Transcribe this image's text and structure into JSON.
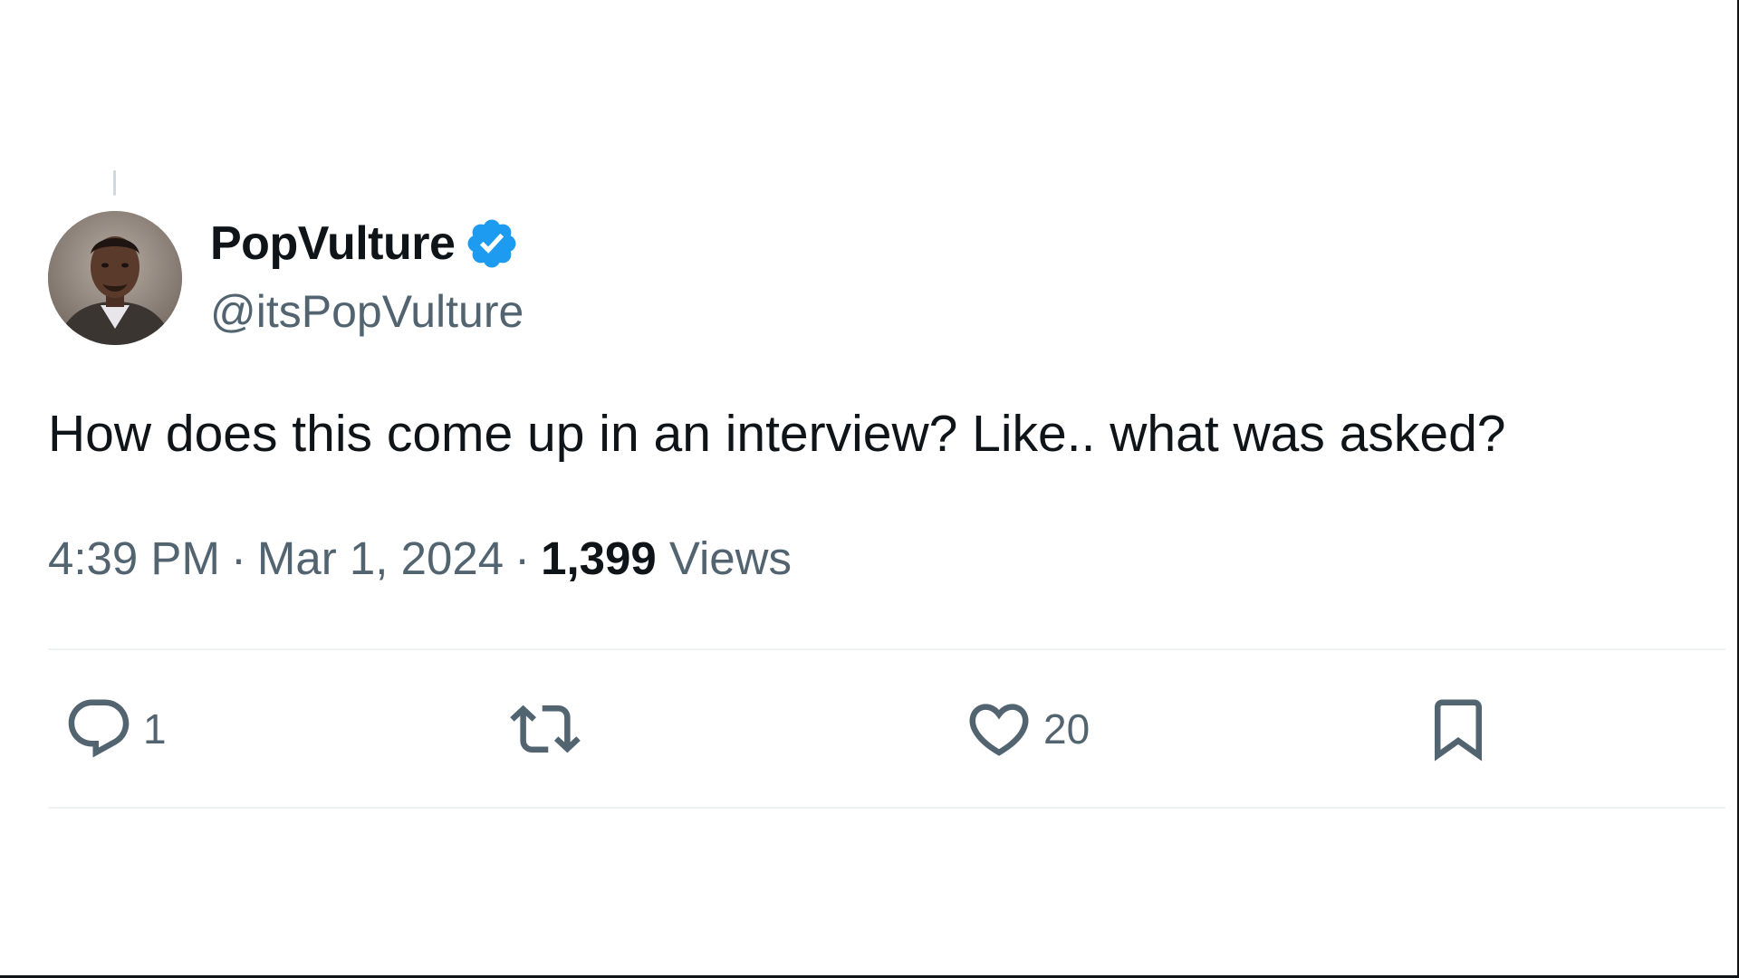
{
  "tweet": {
    "author": {
      "display_name": "PopVulture",
      "handle": "@itsPopVulture",
      "verified": true
    },
    "text": "How does this come up in an interview? Like.. what was asked?",
    "time": "4:39 PM",
    "date": "Mar 1, 2024",
    "views_count": "1,399",
    "views_label": "Views",
    "separator": "·"
  },
  "actions": {
    "reply_count": "1",
    "repost_count": "",
    "like_count": "20",
    "bookmark_count": ""
  },
  "icons": [
    "thread-line",
    "avatar",
    "verified-badge-icon",
    "reply-icon",
    "repost-icon",
    "like-icon",
    "bookmark-icon"
  ],
  "colors": {
    "text_primary": "#0f1419",
    "text_secondary": "#536471",
    "verified_blue": "#1d9bf0",
    "divider": "#eff3f4"
  }
}
